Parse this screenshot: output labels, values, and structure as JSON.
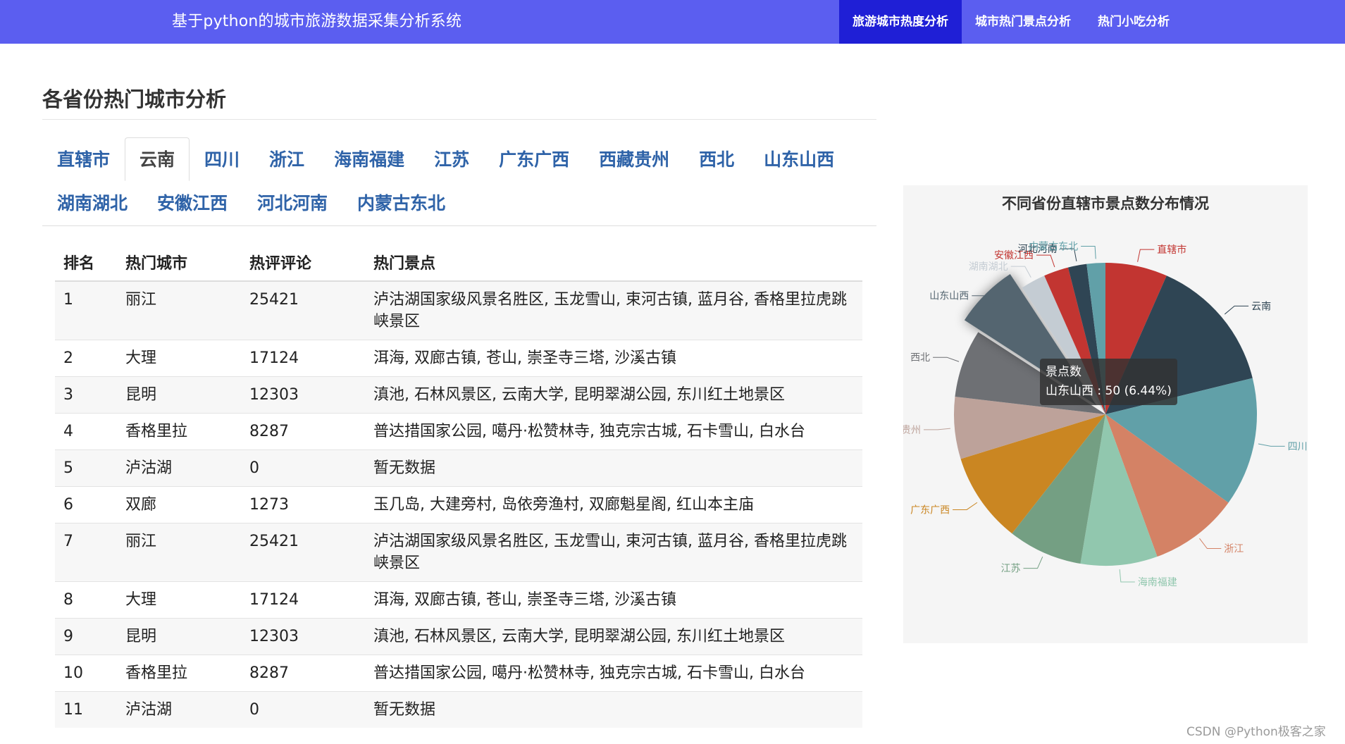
{
  "navbar": {
    "brand": "基于python的城市旅游数据采集分析系统",
    "links": [
      {
        "label": "旅游城市热度分析",
        "active": true
      },
      {
        "label": "城市热门景点分析",
        "active": false
      },
      {
        "label": "热门小吃分析",
        "active": false
      }
    ]
  },
  "section": {
    "title": "各省份热门城市分析"
  },
  "tabs": [
    {
      "label": "直辖市"
    },
    {
      "label": "云南"
    },
    {
      "label": "四川"
    },
    {
      "label": "浙江"
    },
    {
      "label": "海南福建"
    },
    {
      "label": "江苏"
    },
    {
      "label": "广东广西"
    },
    {
      "label": "西藏贵州"
    },
    {
      "label": "西北"
    },
    {
      "label": "山东山西"
    },
    {
      "label": "湖南湖北"
    },
    {
      "label": "安徽江西"
    },
    {
      "label": "河北河南"
    },
    {
      "label": "内蒙古东北"
    }
  ],
  "active_tab": "云南",
  "table": {
    "headers": [
      "排名",
      "热门城市",
      "热评评论",
      "热门景点"
    ],
    "rows": [
      [
        "1",
        "丽江",
        "25421",
        "泸沽湖国家级风景名胜区, 玉龙雪山, 束河古镇, 蓝月谷, 香格里拉虎跳峡景区"
      ],
      [
        "2",
        "大理",
        "17124",
        "洱海, 双廊古镇, 苍山, 崇圣寺三塔, 沙溪古镇"
      ],
      [
        "3",
        "昆明",
        "12303",
        "滇池, 石林风景区, 云南大学, 昆明翠湖公园, 东川红土地景区"
      ],
      [
        "4",
        "香格里拉",
        "8287",
        "普达措国家公园, 噶丹·松赞林寺, 独克宗古城, 石卡雪山, 白水台"
      ],
      [
        "5",
        "泸沽湖",
        "0",
        "暂无数据"
      ],
      [
        "6",
        "双廊",
        "1273",
        "玉几岛, 大建旁村, 岛依旁渔村, 双廊魁星阁, 红山本主庙"
      ],
      [
        "7",
        "丽江",
        "25421",
        "泸沽湖国家级风景名胜区, 玉龙雪山, 束河古镇, 蓝月谷, 香格里拉虎跳峡景区"
      ],
      [
        "8",
        "大理",
        "17124",
        "洱海, 双廊古镇, 苍山, 崇圣寺三塔, 沙溪古镇"
      ],
      [
        "9",
        "昆明",
        "12303",
        "滇池, 石林风景区, 云南大学, 昆明翠湖公园, 东川红土地景区"
      ],
      [
        "10",
        "香格里拉",
        "8287",
        "普达措国家公园, 噶丹·松赞林寺, 独克宗古城, 石卡雪山, 白水台"
      ],
      [
        "11",
        "泸沽湖",
        "0",
        "暂无数据"
      ]
    ]
  },
  "chart_data": {
    "type": "pie",
    "title": "不同省份直辖市景点数分布情况",
    "series_name": "景点数",
    "labels": [
      "直辖市",
      "云南",
      "四川",
      "浙江",
      "海南福建",
      "江苏",
      "广东广西",
      "西藏贵州",
      "西北",
      "山东山西",
      "湖南湖北",
      "安徽江西",
      "河北河南",
      "内蒙古东北"
    ],
    "values": [
      50,
      110,
      104,
      72,
      62,
      60,
      73,
      50,
      55,
      50,
      20,
      20,
      15,
      15
    ],
    "colors": [
      "#c23531",
      "#2f4554",
      "#61a0a8",
      "#d48265",
      "#91c7ae",
      "#749f83",
      "#ca8622",
      "#bda29a",
      "#6e7074",
      "#546570",
      "#c4ccd3",
      "#c23531",
      "#2f4554",
      "#61a0a8"
    ],
    "highlighted": "山东山西",
    "tooltip": {
      "title": "景点数",
      "text": "山东山西 : 50 (6.44%)"
    }
  },
  "watermark": "CSDN @Python极客之家"
}
